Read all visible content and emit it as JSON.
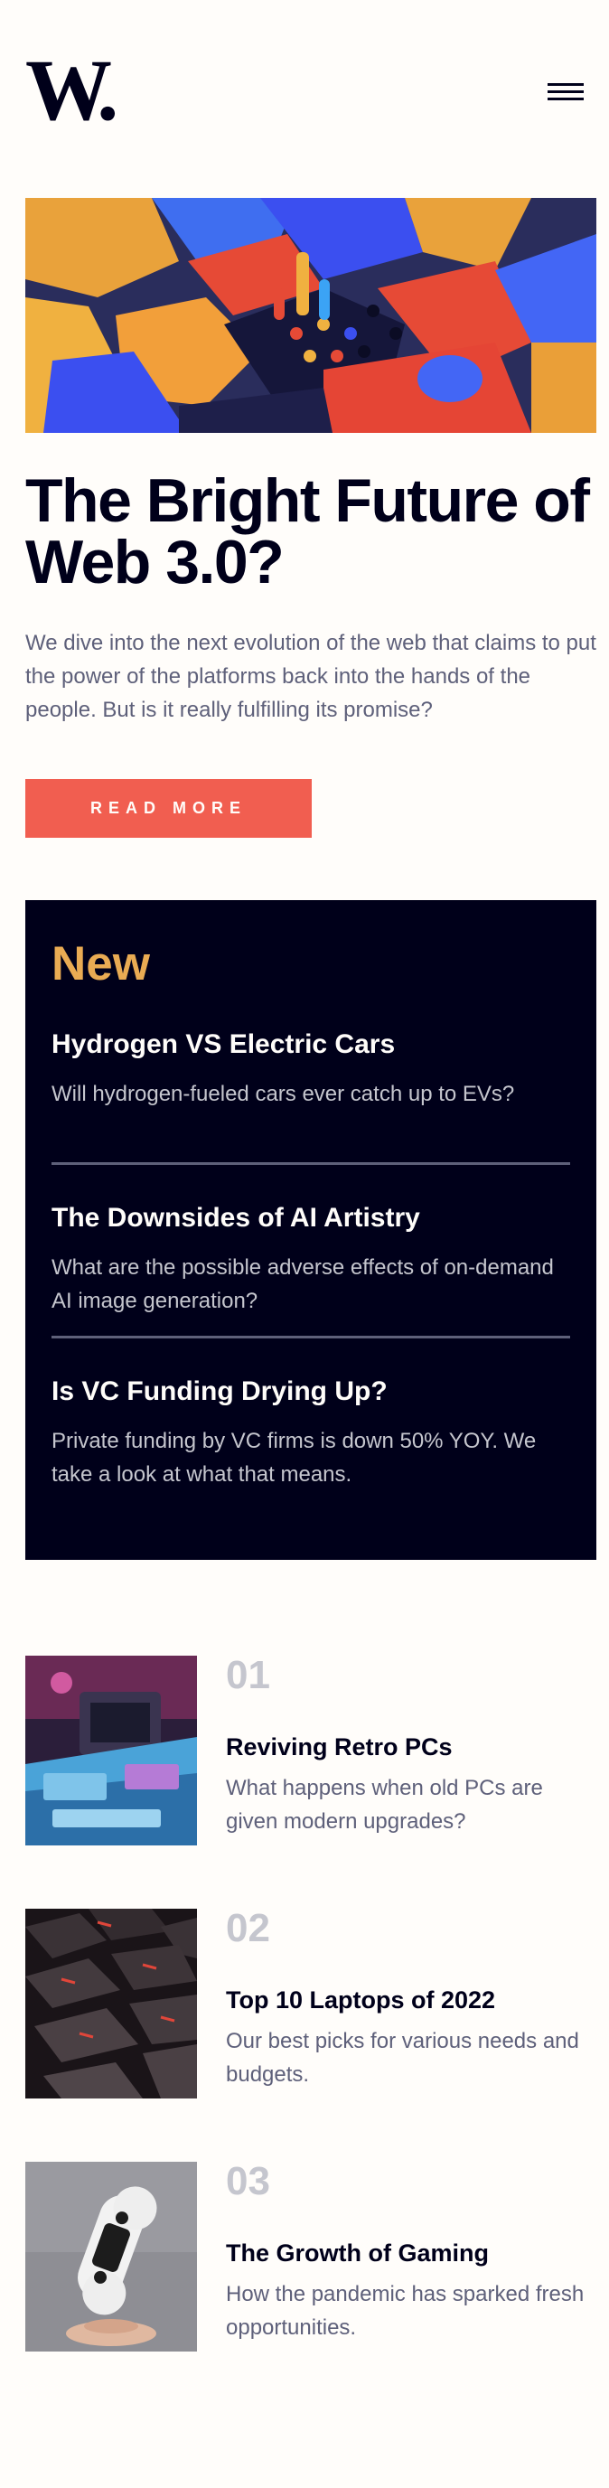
{
  "header": {
    "logo_text": "W.",
    "menu_icon": "hamburger-menu-icon"
  },
  "hero": {
    "image_alt": "abstract 3D colorful blocks",
    "title": "The Bright Future of Web 3.0?",
    "description": "We dive into the next evolution of the web that claims to put the power of the platforms back into the hands of the people. But is it really fulfilling its promise?",
    "button_label": "READ MORE"
  },
  "new_section": {
    "title": "New",
    "items": [
      {
        "title": "Hydrogen VS Electric Cars",
        "description": "Will hydrogen-fueled cars ever catch up to EVs?"
      },
      {
        "title": "The Downsides of AI Artistry",
        "description": "What are the possible adverse effects of on-demand AI image generation?"
      },
      {
        "title": "Is VC Funding Drying Up?",
        "description": "Private funding by VC firms is down 50% YOY. We take a look at what that means."
      }
    ]
  },
  "trending": [
    {
      "number": "01",
      "title": "Reviving Retro PCs",
      "description": "What happens when old PCs are given modern upgrades?"
    },
    {
      "number": "02",
      "title": "Top 10 Laptops of 2022",
      "description": "Our best picks for various needs and budgets."
    },
    {
      "number": "03",
      "title": "The Growth of Gaming",
      "description": "How the pandemic has sparked fresh opportunities."
    }
  ],
  "colors": {
    "background": "#fffdfa",
    "dark_navy": "#00001a",
    "accent_red": "#f15e50",
    "accent_orange": "#e9ab53",
    "grayish_blue": "#5e607a",
    "light_gray": "#c5c6ce"
  }
}
